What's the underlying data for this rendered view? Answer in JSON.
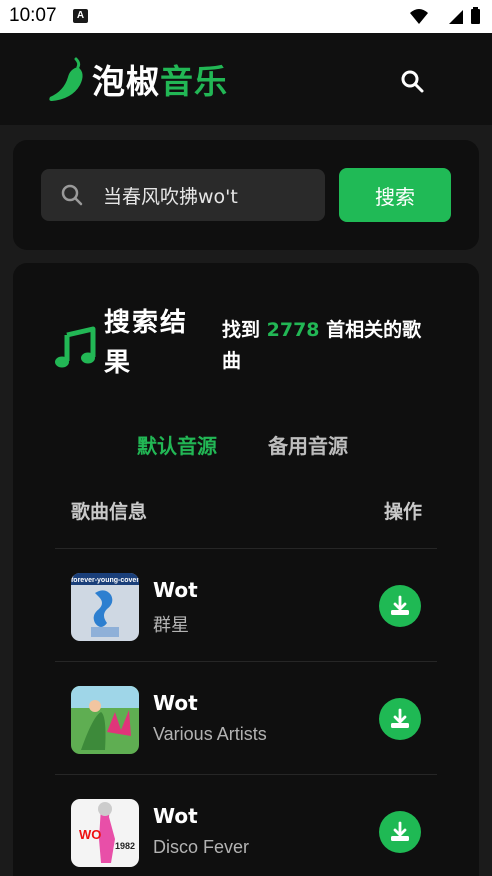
{
  "status_bar": {
    "time": "10:07",
    "notification_badge": "A"
  },
  "header": {
    "logo_text_1": "泡椒",
    "logo_text_2": "音乐",
    "logo_icon": "chili-pepper-icon",
    "search_icon": "search-icon"
  },
  "search": {
    "value": "当春风吹拂wo't",
    "button_label": "搜索"
  },
  "results": {
    "title": "搜索结果",
    "summary_prefix": "找到 ",
    "count": "2778",
    "summary_suffix": " 首相关的歌曲",
    "tabs": [
      {
        "label": "默认音源",
        "active": true
      },
      {
        "label": "备用音源",
        "active": false
      }
    ],
    "columns": {
      "info": "歌曲信息",
      "action": "操作"
    },
    "songs": [
      {
        "title": "Wot",
        "artist": "群星",
        "cover": "forever-young-cover"
      },
      {
        "title": "Wot",
        "artist": "Various Artists",
        "cover": "tropical-cover"
      },
      {
        "title": "Wot",
        "artist": "Disco Fever",
        "cover": "disco-1982-cover"
      }
    ]
  },
  "colors": {
    "accent": "#22b755",
    "background": "#1b1b1b",
    "card": "#0f0f0f",
    "header": "#101010"
  }
}
